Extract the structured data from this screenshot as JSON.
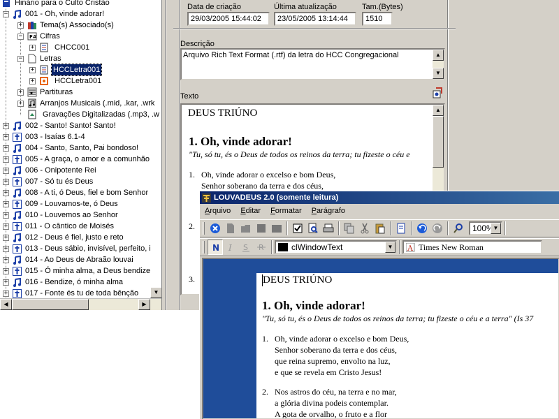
{
  "tree": {
    "root_label": "Hinário para o Culto Cristão",
    "hymn_open_label": "001 - Oh, vinde adorar!",
    "children": [
      {
        "label": "Tema(s) Associado(s)"
      },
      {
        "label": "Cifras"
      },
      {
        "label": "CHCC001"
      },
      {
        "label": "Letras"
      },
      {
        "label": "HCCLetra001"
      },
      {
        "label": "HCCLetra001"
      },
      {
        "label": "Partituras"
      },
      {
        "label": "Arranjos Musicais (.mid, .kar, .wrk"
      },
      {
        "label": "Gravações Digitalizadas (.mp3, .w"
      }
    ],
    "hymns": [
      "002 - Santo! Santo! Santo!",
      "003 - Isaías 6.1-4",
      "004 - Santo, Santo, Pai bondoso!",
      "005 - A graça, o amor e a comunhão",
      "006 - Onipotente Rei",
      "007 - Só tu és Deus",
      "008 - A ti, ó Deus, fiel e bom Senhor",
      "009 - Louvamos-te, ó Deus",
      "010 - Louvemos ao Senhor",
      "011 - O cântico de Moisés",
      "012 - Deus é fiel, justo e reto",
      "013 - Deus sábio, invisível, perfeito, i",
      "014 - Ao Deus de Abraão louvai",
      "015 - Ó minha alma, a Deus bendize",
      "016 - Bendize, ó minha alma",
      "017 - Fonte és tu de toda bênção"
    ]
  },
  "props": {
    "created_label": "Data de criação",
    "created_value": "29/03/2005 15:44:02",
    "updated_label": "Última atualização",
    "updated_value": "23/05/2005 13:14:44",
    "size_label": "Tam.(Bytes)",
    "size_value": "1510",
    "desc_label": "Descrição",
    "desc_value": "Arquivo Rich Text Format (.rtf) da letra do HCC Congregacional",
    "text_label": "Texto",
    "text_title": "DEUS TRIÚNO",
    "text_song": "1.  Oh, vinde adorar!",
    "text_verse": "\"Tu, só tu, és o Deus de todos os reinos da terra; tu fizeste o céu e",
    "text_stanza_num": "1.",
    "text_lines": [
      "Oh, vinde adorar o excelso e bom Deus,",
      "Senhor soberano da terra e dos céus,"
    ],
    "text_num2": "2.",
    "text_num3": "3."
  },
  "window": {
    "title": "LOUVADEUS 2.0 (somente leitura)",
    "menu": [
      {
        "ul": "A",
        "rest": "rquivo"
      },
      {
        "ul": "E",
        "rest": "ditar"
      },
      {
        "ul": "F",
        "rest": "ormatar"
      },
      {
        "ul": "P",
        "rest": "arágrafo"
      }
    ],
    "zoom": "100%",
    "color_value": "clWindowText",
    "font_value": "Times New Roman",
    "doc": {
      "title": "DEUS TRIÚNO",
      "song": "1.  Oh, vinde adorar!",
      "verse": "\"Tu, só tu, és o Deus de todos os reinos da terra; tu fizeste o céu e a terra\" (Is 37",
      "stanza1_num": "1.",
      "stanza1": [
        "Oh, vinde adorar o excelso e bom Deus,",
        "Senhor soberano da terra e dos céus,",
        "que reina supremo, envolto na luz,",
        "e que se revela em Cristo Jesus!"
      ],
      "stanza2_num": "2.",
      "stanza2": [
        "Nos astros do céu, na terra e no mar,",
        "a glória divina podeis contemplar.",
        "A gota de orvalho, o fruto e a flor"
      ]
    }
  },
  "colors": {
    "titlebar": "#0a246a",
    "selection": "#0a246a",
    "editor_bg": "#1f4d9a",
    "chrome": "#d4d0c8"
  }
}
